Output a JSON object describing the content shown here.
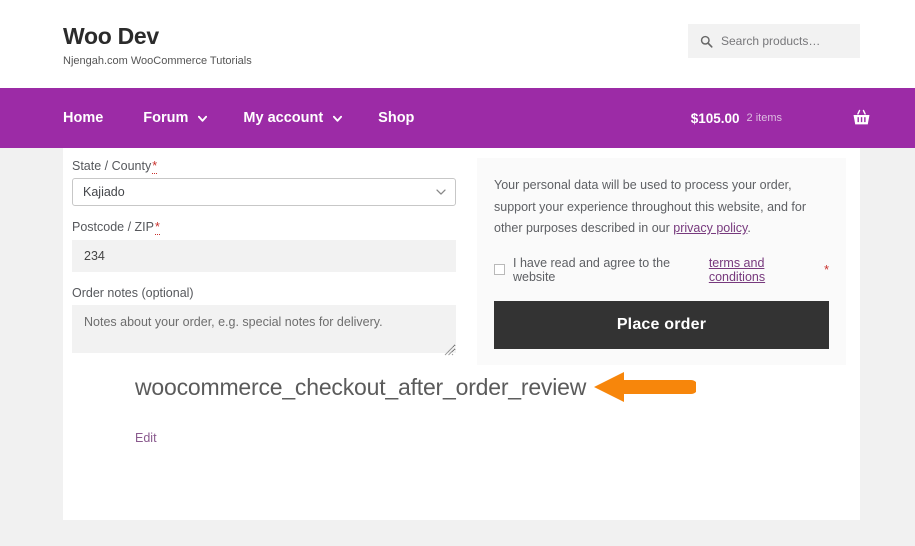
{
  "header": {
    "brand_title": "Woo Dev",
    "brand_tagline": "Njengah.com WooCommerce Tutorials",
    "search": {
      "placeholder": "Search products…",
      "icon": "search-icon"
    }
  },
  "nav": {
    "items": [
      {
        "label": "Home",
        "has_dropdown": false
      },
      {
        "label": "Forum",
        "has_dropdown": true
      },
      {
        "label": "My account",
        "has_dropdown": true
      },
      {
        "label": "Shop",
        "has_dropdown": false
      }
    ],
    "cart": {
      "total": "$105.00",
      "count_label": "2 items",
      "icon": "shopping-basket-icon"
    },
    "background_color": "#9c2ba6"
  },
  "checkout": {
    "state_field": {
      "label": "State / County",
      "required_mark": "*",
      "value": "Kajiado",
      "icon": "chevron-down-icon"
    },
    "postcode_field": {
      "label": "Postcode / ZIP",
      "required_mark": "*",
      "value": "234"
    },
    "order_notes_field": {
      "label": "Order notes (optional)",
      "placeholder": "Notes about your order, e.g. special notes for delivery."
    }
  },
  "order_review": {
    "privacy_text_before": "Your personal data will be used to process your order, support your experience throughout this website, and for other purposes described in our ",
    "privacy_link": "privacy policy",
    "privacy_text_after": ".",
    "terms_text_before": "I have read and agree to the website ",
    "terms_link": "terms and conditions",
    "terms_required_mark": "*",
    "place_order_label": "Place order",
    "button_color": "#333333"
  },
  "annotation": {
    "hook_name": "woocommerce_checkout_after_order_review",
    "arrow_color": "#f7860b",
    "arrow_direction": "left"
  },
  "footer": {
    "edit_label": "Edit"
  }
}
